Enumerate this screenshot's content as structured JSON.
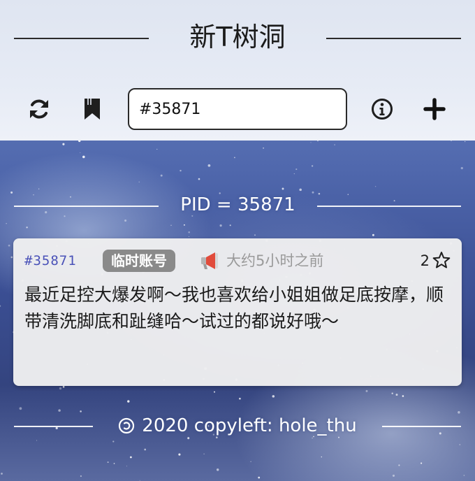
{
  "header": {
    "title": "新T树洞",
    "search": {
      "value": "#35871",
      "placeholder": ""
    },
    "icons": [
      "refresh-icon",
      "bookmark-icon",
      "info-icon",
      "plus-icon"
    ]
  },
  "divider": {
    "pid_label": "PID = 35871"
  },
  "post": {
    "id": "#35871",
    "badge": "临时账号",
    "time": "大约5小时之前",
    "star_count": "2",
    "content": "最近足控大爆发啊～我也喜欢给小姐姐做足底按摩，顺带清洗脚底和趾缝哈～试过的都说好哦～",
    "colors": {
      "id": "#4a52b8",
      "badge_bg": "#8a8a8a",
      "time": "#9a9a9a"
    }
  },
  "footer": {
    "text": "2020 copyleft: hole_thu"
  }
}
